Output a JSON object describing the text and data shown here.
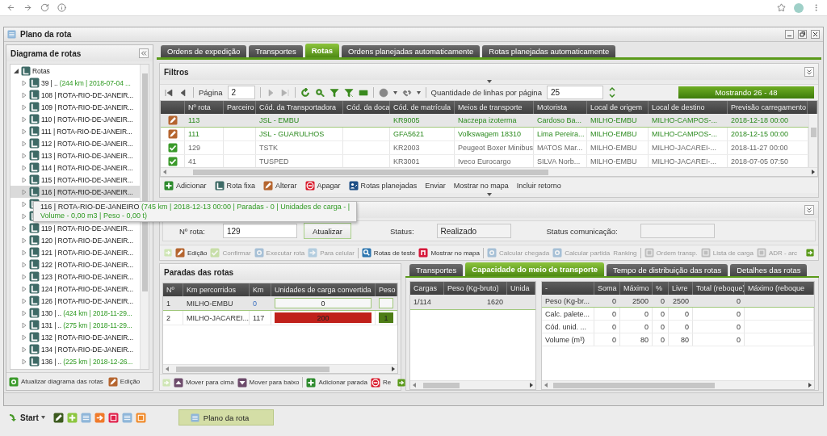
{
  "window": {
    "title": "Plano da rota"
  },
  "route_diagram": {
    "title": "Diagrama de rotas",
    "tree": {
      "label": "Rotas",
      "expanded": true,
      "children": [
        {
          "label": "39 | .. ",
          "detail": "(244 km | 2018-07-04 ...",
          "expanded": false,
          "hovered": false
        },
        {
          "label": "108 | ROTA-RIO-DE-JANEIR...",
          "expanded": false,
          "hovered": false
        },
        {
          "label": "109 | ROTA-RIO-DE-JANEIR...",
          "expanded": false,
          "hovered": false
        },
        {
          "label": "110 | ROTA-RIO-DE-JANEIR...",
          "expanded": false,
          "hovered": false
        },
        {
          "label": "111 | ROTA-RIO-DE-JANEIR...",
          "expanded": false,
          "hovered": false
        },
        {
          "label": "112 | ROTA-RIO-DE-JANEIR...",
          "expanded": false,
          "hovered": false
        },
        {
          "label": "113 | ROTA-RIO-DE-JANEIR...",
          "expanded": false,
          "hovered": false
        },
        {
          "label": "114 | ROTA-RIO-DE-JANEIR...",
          "expanded": false,
          "hovered": false
        },
        {
          "label": "115 | ROTA-RIO-DE-JANEIR...",
          "expanded": false,
          "hovered": false
        },
        {
          "label": "116 | ROTA-RIO-DE-JANEIR...",
          "expanded": false,
          "hovered": true
        },
        {
          "expanded": false,
          "hovered": false
        },
        {
          "expanded": false,
          "hovered": false
        },
        {
          "label": "119 | ROTA-RIO-DE-JANEIR...",
          "expanded": false,
          "hovered": false
        },
        {
          "label": "120 | ROTA-RIO-DE-JANEIR...",
          "expanded": false,
          "hovered": false
        },
        {
          "label": "121 | ROTA-RIO-DE-JANEIR...",
          "expanded": false,
          "hovered": false
        },
        {
          "label": "122 | ROTA-RIO-DE-JANEIR...",
          "expanded": false,
          "hovered": false
        },
        {
          "label": "123 | ROTA-RIO-DE-JANEIR...",
          "expanded": false,
          "hovered": false
        },
        {
          "label": "124 | ROTA-RIO-DE-JANEIR...",
          "expanded": false,
          "hovered": false
        },
        {
          "label": "126 | ROTA-RIO-DE-JANEIR...",
          "expanded": false,
          "hovered": false
        },
        {
          "label": "130 | .. ",
          "detail": "(424 km | 2018-11-29...",
          "expanded": false,
          "hovered": false
        },
        {
          "label": "131 | .. ",
          "detail": "(275 km | 2018-11-29...",
          "expanded": false,
          "hovered": false
        },
        {
          "label": "132 | ROTA-RIO-DE-JANEIR...",
          "expanded": false,
          "hovered": false
        },
        {
          "label": "134 | ROTA-RIO-DE-JANEIR...",
          "expanded": false,
          "hovered": false
        },
        {
          "label": "136 | .. ",
          "detail": "(225 km | 2018-12-26...",
          "expanded": false,
          "hovered": false
        }
      ]
    },
    "buttons": [
      "Atualizar diagrama das rotas",
      "Edição"
    ]
  },
  "tooltip": {
    "title": "116 | ROTA-RIO-DE-JANEIRO ",
    "lines": [
      "(745 km | 2018-12-13 00:00 | Paradas - 0 | Unidades de carga - |",
      "Volume - 0,00 m3 | Peso - 0,00 t)"
    ]
  },
  "main_tabs": [
    {
      "label": "Ordens de expedição",
      "selected": false
    },
    {
      "label": "Transportes",
      "selected": false
    },
    {
      "label": "Rotas",
      "selected": true
    },
    {
      "label": "Ordens planejadas automaticamente",
      "selected": false
    },
    {
      "label": "Rotas planejadas automaticamente",
      "selected": false
    }
  ],
  "filters": {
    "title": "Filtros"
  },
  "pager": {
    "page_label": "Página",
    "page": "2",
    "rows_label": "Quantidade de linhas por página",
    "rows_per_page": "25",
    "showing": "Mostrando 26 - 48"
  },
  "routes_table": {
    "columns": [
      "Nº rota",
      "Parceiro",
      "Cód. da Transportadora",
      "Cód. da doca",
      "Cód. de matrícula",
      "Meios de transporte",
      "Motorista",
      "Local de origem",
      "Local de destino",
      "Previsão carregamento"
    ],
    "rows": [
      {
        "editing": true,
        "selected": true,
        "cells": [
          "113",
          null,
          "JSL - EMBU",
          null,
          "KR9005",
          "Naczepa izoterma",
          "Cardoso Ba...",
          "MILHO-EMBU",
          "MILHO-CAMPOS-...",
          "2018-12-18 00:00"
        ]
      },
      {
        "editing": true,
        "selected": false,
        "cells": [
          "111",
          null,
          "JSL - GUARULHOS",
          null,
          "GFA5621",
          "Volkswagem 18310",
          "Lima Pereira...",
          "MILHO-EMBU",
          "MILHO-CAMPOS-...",
          "2018-12-15 00:00"
        ]
      },
      {
        "editing": false,
        "selected": false,
        "cells": [
          "129",
          null,
          "TSTK",
          null,
          "KR2003",
          "Peugeot Boxer Minibus",
          "MATOS Mar...",
          "MILHO-EMBU",
          "MILHO-JACAREI-...",
          "2018-11-27 00:00"
        ]
      },
      {
        "editing": false,
        "selected": false,
        "cells": [
          "41",
          null,
          "TUSPED",
          null,
          "KR3001",
          "Iveco Eurocargo",
          "SILVA Norb...",
          "MILHO-EMBU",
          "MILHO-JACAREI-...",
          "2018-07-05 07:50"
        ]
      }
    ]
  },
  "route_actions": [
    "Adicionar",
    "Rota fixa",
    "Alterar",
    "Apagar",
    "Rotas planejadas",
    "Enviar",
    "Mostrar no mapa",
    "Incluir retorno"
  ],
  "route_form": {
    "route_label": "Nº rota:",
    "route": "129",
    "refresh": "Atualizar",
    "status_label": "Status:",
    "status": "Realizado",
    "comm_label": "Status comunicação:"
  },
  "route_tools": [
    {
      "label": "Edição",
      "disabled": false
    },
    {
      "label": "Confirmar",
      "disabled": true
    },
    {
      "label": "Executar rota",
      "disabled": true
    },
    {
      "label": "Para celular",
      "disabled": true
    },
    {
      "label": "Rotas de teste",
      "disabled": false
    },
    {
      "label": "Mostrar no mapa",
      "disabled": false
    },
    {
      "label": "Calcular chegada",
      "disabled": true
    },
    {
      "label": "Calcular partida",
      "disabled": true
    },
    {
      "label": "Ranking",
      "disabled": true
    },
    {
      "label": "Ordem transp.",
      "disabled": true
    },
    {
      "label": "Lista de carga",
      "disabled": true
    },
    {
      "label": "ADR - arc",
      "disabled": true
    }
  ],
  "stops": {
    "title": "Paradas das rotas",
    "columns": [
      "Nº",
      "Km percorridos",
      "Km",
      "Unidades de carga convertida",
      "Peso"
    ],
    "rows": [
      {
        "selected": true,
        "cells": [
          "1",
          "MILHO-EMBU",
          "0"
        ],
        "km_highlighted": true,
        "load": {
          "value": "0",
          "level": 0
        },
        "weight": {
          "level": 0
        }
      },
      {
        "selected": false,
        "cells": [
          "2",
          "MILHO-JACAREI...",
          "117"
        ],
        "km_highlighted": false,
        "load": {
          "value": "200",
          "level": 1
        },
        "weight": {
          "value": "1",
          "level": 1
        }
      }
    ],
    "actions": [
      "Mover para cima",
      "Mover para baixo",
      "Adicionar parada",
      "Re"
    ]
  },
  "detail_tabs": [
    {
      "label": "Transportes",
      "selected": false
    },
    {
      "label": "Capacidade do meio de transporte",
      "selected": true
    },
    {
      "label": "Tempo de distribuição das rotas",
      "selected": false
    },
    {
      "label": "Detalhes das rotas",
      "selected": false
    }
  ],
  "cargo_table": {
    "columns": [
      "Cargas",
      "Peso (Kg-bruto)",
      "Unida"
    ],
    "rows": [
      {
        "selected": true,
        "cells": [
          "1/114",
          "1620",
          null
        ]
      }
    ]
  },
  "capacity_table": {
    "columns": [
      "-",
      "Soma",
      "Máximo",
      "%",
      "Livre",
      "Total (reboque)",
      "Máximo (reboque"
    ],
    "rows": [
      {
        "selected": true,
        "cells": [
          "Peso (Kg-br...",
          "0",
          "2500",
          "0",
          "2500",
          "0",
          null
        ]
      },
      {
        "selected": false,
        "cells": [
          "Calc. palete...",
          "0",
          "0",
          "0",
          "0",
          "0",
          null
        ]
      },
      {
        "selected": false,
        "cells": [
          "Cód. unid. ...",
          "0",
          "0",
          "0",
          "0",
          "0",
          null
        ]
      },
      {
        "selected": false,
        "cells": [
          "Volume (m³)",
          "0",
          "80",
          "0",
          "80",
          "0",
          null
        ]
      }
    ]
  },
  "taskbar": {
    "start": "Start",
    "tasks": [
      {
        "label": "Plano da rota",
        "selected": true
      }
    ]
  }
}
